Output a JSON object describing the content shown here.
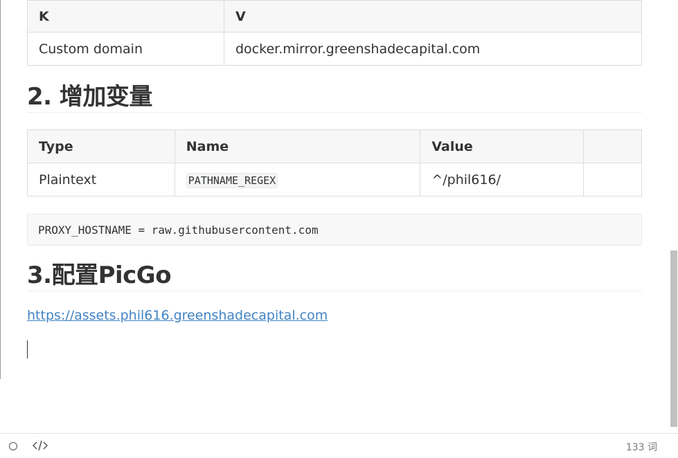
{
  "table1": {
    "headers": [
      "K",
      "V"
    ],
    "rows": [
      [
        "Custom domain",
        "docker.mirror.greenshadecapital.com"
      ]
    ]
  },
  "heading2": "2. 增加变量",
  "table2": {
    "headers": [
      "Type",
      "Name",
      "Value",
      ""
    ],
    "rows": [
      [
        "Plaintext",
        "PATHNAME_REGEX",
        "^/phil616/",
        ""
      ]
    ]
  },
  "code_block": "PROXY_HOSTNAME = raw.githubusercontent.com",
  "heading3": "3.配置PicGo",
  "link": "https://assets.phil616.greenshadecapital.com",
  "status": {
    "word_count": "133 词",
    "left_icons": [
      "circle-icon",
      "code-icon"
    ]
  }
}
